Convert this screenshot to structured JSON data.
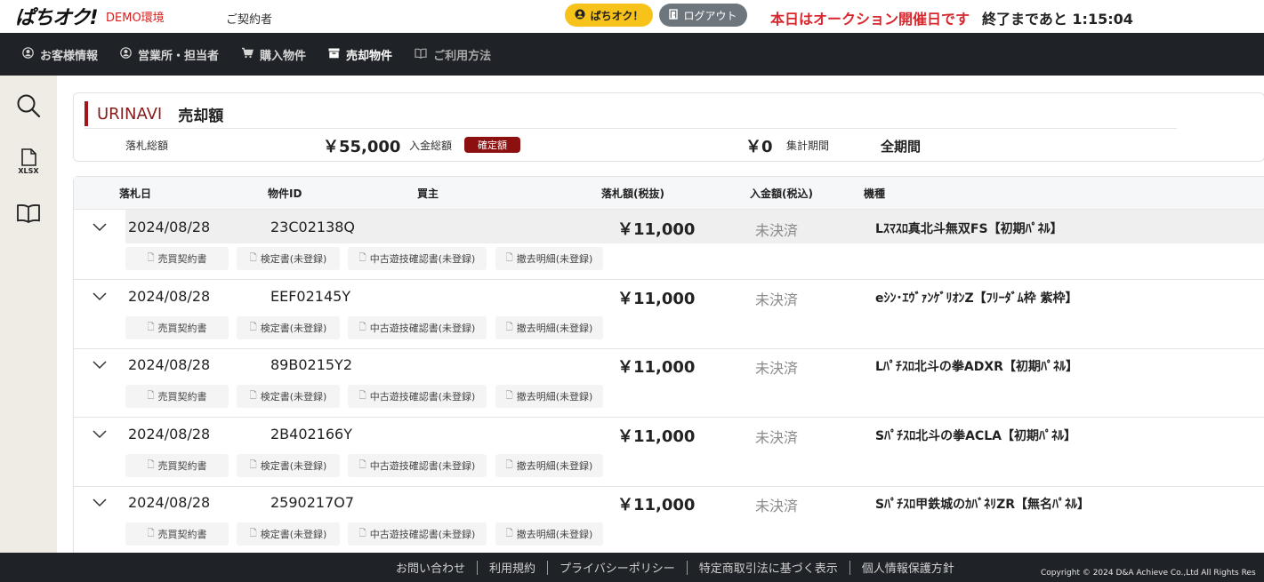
{
  "header": {
    "logo": "ぱちオク!",
    "env_label": "DEMO環境",
    "contractor": "ご契約者",
    "pachioku_button": "ぱちオク！",
    "logout_button": "ログアウト",
    "notice": "本日はオークション開催日です",
    "remaining": "終了まであと 1:15:04"
  },
  "nav": {
    "items": [
      {
        "label": "お客様情報",
        "icon": "user-circle-icon"
      },
      {
        "label": "営業所・担当者",
        "icon": "user-circle-icon"
      },
      {
        "label": "購入物件",
        "icon": "cart-icon"
      },
      {
        "label": "売却物件",
        "icon": "box-icon",
        "active": true
      },
      {
        "label": "ご利用方法",
        "icon": "book-icon"
      }
    ]
  },
  "sidebar": {
    "icons": [
      "search-icon",
      "xlsx-file-icon",
      "book-icon"
    ],
    "xlsx_label": "XLSX"
  },
  "summary": {
    "brand": "URINAVI",
    "title": "売却額",
    "bid_total_label": "落札総額",
    "bid_total_value": "￥55,000",
    "deposit_total_label": "入金総額",
    "badge": "確定額",
    "deposit_total_value": "￥0",
    "period_label": "集計期間",
    "period_value": "全期間"
  },
  "table": {
    "columns": [
      "落札日",
      "物件ID",
      "買主",
      "落札額(税抜)",
      "入金額(税込)",
      "機種"
    ],
    "doc_buttons": [
      "売買契約書",
      "検定書(未登録)",
      "中古遊技確認書(未登録)",
      "撤去明細(未登録)"
    ],
    "rows": [
      {
        "date": "2024/08/28",
        "id": "23C02138Q",
        "buyer": "",
        "price": "￥11,000",
        "status": "未決済",
        "model": "Lｽﾏｽﾛ真北斗無双FS【初期ﾊﾟﾈﾙ】"
      },
      {
        "date": "2024/08/28",
        "id": "EEF02145Y",
        "buyer": "",
        "price": "￥11,000",
        "status": "未決済",
        "model": "eｼﾝ･ｴｳﾞｧﾝｹﾞﾘｵﾝZ【ﾌﾘｰﾀﾞﾑ枠 紫枠】"
      },
      {
        "date": "2024/08/28",
        "id": "89B0215Y2",
        "buyer": "",
        "price": "￥11,000",
        "status": "未決済",
        "model": "Lﾊﾟﾁｽﾛ北斗の拳ADXR【初期ﾊﾟﾈﾙ】"
      },
      {
        "date": "2024/08/28",
        "id": "2B402166Y",
        "buyer": "",
        "price": "￥11,000",
        "status": "未決済",
        "model": "Sﾊﾟﾁｽﾛ北斗の拳ACLA【初期ﾊﾟﾈﾙ】"
      },
      {
        "date": "2024/08/28",
        "id": "2590217O7",
        "buyer": "",
        "price": "￥11,000",
        "status": "未決済",
        "model": "Sﾊﾟﾁｽﾛ甲鉄城のｶﾊﾞﾈﾘZR【無名ﾊﾟﾈﾙ】"
      }
    ]
  },
  "footer": {
    "links": [
      "お問い合わせ",
      "利用規約",
      "プライバシーポリシー",
      "特定商取引法に基づく表示",
      "個人情報保護方針"
    ],
    "copyright": "Copyright © 2024 D&A Achieve Co.,Ltd All Rights Res"
  }
}
